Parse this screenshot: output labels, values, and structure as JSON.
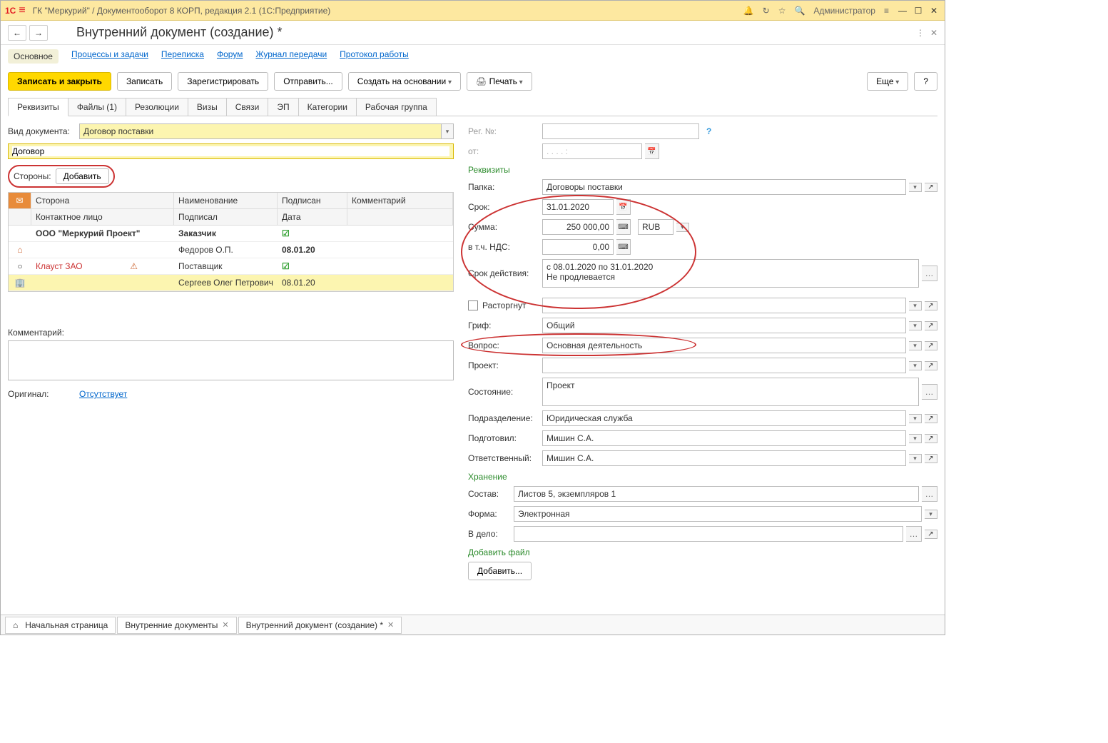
{
  "titlebar": {
    "logo": "1С",
    "title": "ГК \"Меркурий\" / Документооборот 8 КОРП, редакция 2.1  (1С:Предприятие)",
    "user": "Администратор"
  },
  "toolbar": {
    "page_title": "Внутренний документ (создание) *"
  },
  "nav_links": [
    "Основное",
    "Процессы и задачи",
    "Переписка",
    "Форум",
    "Журнал передачи",
    "Протокол работы"
  ],
  "actions": {
    "save_close": "Записать и закрыть",
    "save": "Записать",
    "register": "Зарегистрировать",
    "send": "Отправить...",
    "create_based": "Создать на основании",
    "print": "Печать",
    "more": "Еще",
    "help": "?"
  },
  "tabs": [
    "Реквизиты",
    "Файлы (1)",
    "Резолюции",
    "Визы",
    "Связи",
    "ЭП",
    "Категории",
    "Рабочая группа"
  ],
  "left": {
    "doc_type_label": "Вид документа:",
    "doc_type_value": "Договор поставки",
    "title_value": "Договор",
    "parties_label": "Стороны:",
    "add_btn": "Добавить",
    "table": {
      "h_party": "Сторона",
      "h_name": "Наименование",
      "h_signed": "Подписан",
      "h_comment": "Комментарий",
      "h_contact": "Контактное лицо",
      "h_signer": "Подписал",
      "h_date": "Дата",
      "rows": [
        {
          "party": "ООО \"Меркурий Проект\"",
          "name": "Заказчик",
          "signed": true,
          "contact": "",
          "signer": "Федоров О.П.",
          "date": "08.01.20",
          "warn": false
        },
        {
          "party": "Клауст ЗАО",
          "name": "Поставщик",
          "signed": true,
          "contact": "",
          "signer": "Сергеев Олег Петрович",
          "date": "08.01.20",
          "warn": true
        }
      ]
    },
    "comment_label": "Комментарий:",
    "original_label": "Оригинал:",
    "original_value": "Отсутствует"
  },
  "right": {
    "reg_no_label": "Рег. №:",
    "from_label": "от:",
    "from_placeholder": ". .   . .   :",
    "sec_req": "Реквизиты",
    "folder_label": "Папка:",
    "folder_value": "Договоры поставки",
    "term_label": "Срок:",
    "term_value": "31.01.2020",
    "sum_label": "Сумма:",
    "sum_value": "250 000,00",
    "currency": "RUB",
    "vat_label": "в т.ч. НДС:",
    "vat_value": "0,00",
    "validity_label": "Срок действия:",
    "validity_value": "с 08.01.2020 по 31.01.2020\nНе продлевается",
    "terminated_label": "Расторгнут",
    "classification_label": "Гриф:",
    "classification_value": "Общий",
    "question_label": "Вопрос:",
    "question_value": "Основная деятельность",
    "project_label": "Проект:",
    "state_label": "Состояние:",
    "state_value": "Проект",
    "department_label": "Подразделение:",
    "department_value": "Юридическая служба",
    "prepared_label": "Подготовил:",
    "prepared_value": "Мишин С.А.",
    "responsible_label": "Ответственный:",
    "responsible_value": "Мишин С.А.",
    "sec_storage": "Хранение",
    "composition_label": "Состав:",
    "composition_value": "Листов 5, экземпляров 1",
    "form_label": "Форма:",
    "form_value": "Электронная",
    "case_label": "В дело:",
    "sec_addfile": "Добавить файл",
    "addfile_btn": "Добавить..."
  },
  "bottom_tabs": [
    "Начальная страница",
    "Внутренние документы",
    "Внутренний документ (создание) *"
  ]
}
